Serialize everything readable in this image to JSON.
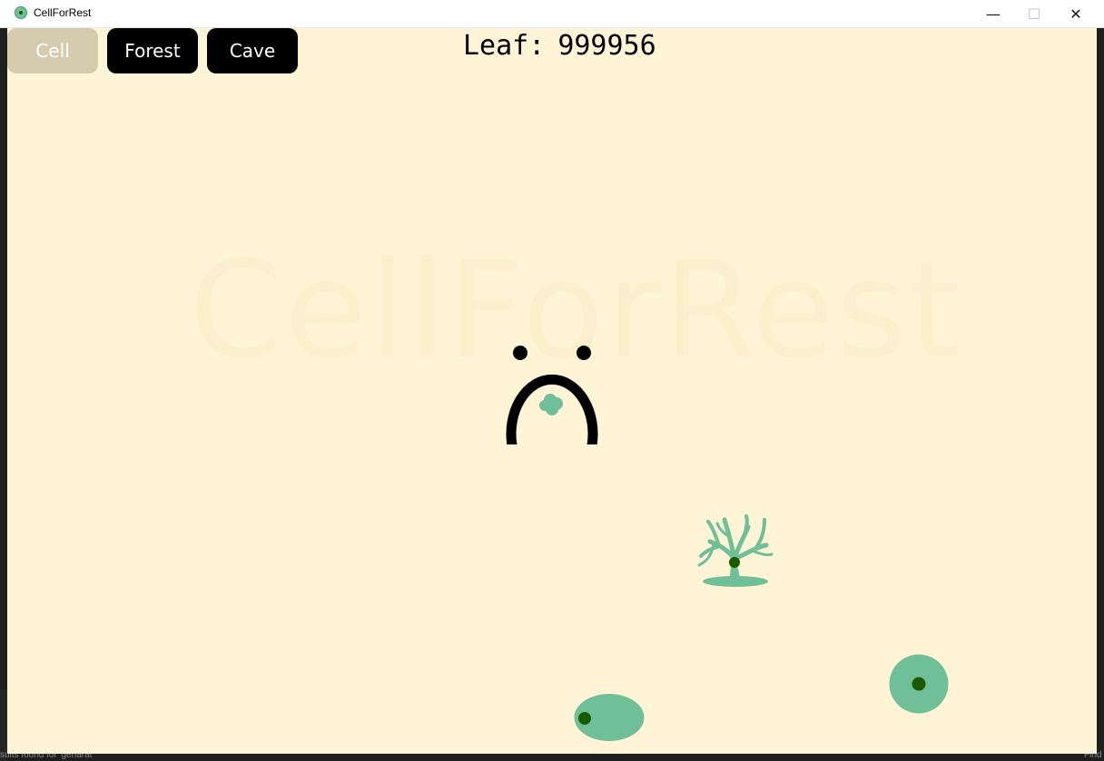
{
  "window": {
    "title": "CellForRest",
    "controls": {
      "minimize": "—",
      "maximize": "☐",
      "close": "✕"
    }
  },
  "toolbar": {
    "buttons": [
      {
        "label": "Cell",
        "active": true
      },
      {
        "label": "Forest",
        "active": false
      },
      {
        "label": "Cave",
        "active": false
      }
    ]
  },
  "hud": {
    "leaf_label": "Leaf:",
    "leaf_value": "999956"
  },
  "background": {
    "watermark": "CellForRest"
  },
  "ide_fragments": {
    "find_status": "sults found for 'genarat'",
    "right_text": "Find"
  },
  "colors": {
    "canvas": "#fff5d6",
    "cell_green": "#6fbf98",
    "nucleus": "#1a5a00",
    "active_button": "#d5ccb0",
    "button": "#000000"
  }
}
